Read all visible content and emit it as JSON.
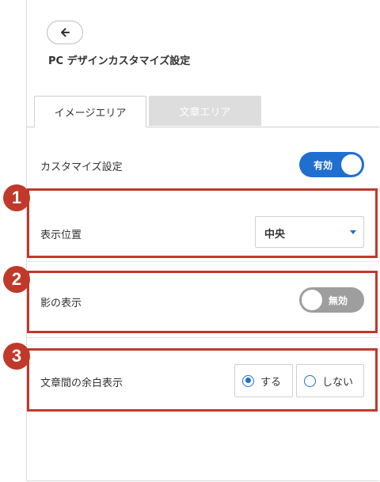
{
  "header": {
    "back_icon": "arrow-left-icon",
    "title": "PC デザインカスタマイズ設定"
  },
  "tabs": [
    {
      "label": "イメージエリア",
      "active": true
    },
    {
      "label": "文章エリア",
      "active": false
    }
  ],
  "settings": {
    "customize": {
      "label": "カスタマイズ設定",
      "toggle_text": "有効",
      "enabled": true
    },
    "position": {
      "label": "表示位置",
      "selected": "中央"
    },
    "shadow": {
      "label": "影の表示",
      "toggle_text": "無効",
      "enabled": false
    },
    "spacing": {
      "label": "文章間の余白表示",
      "options": [
        {
          "label": "する",
          "checked": true
        },
        {
          "label": "しない",
          "checked": false
        }
      ]
    }
  },
  "markers": [
    "1",
    "2",
    "3"
  ],
  "colors": {
    "accent": "#1f6fd1",
    "highlight": "#c0392b",
    "toggle_off": "#9e9e9e",
    "tab_inactive": "#dddddd"
  }
}
